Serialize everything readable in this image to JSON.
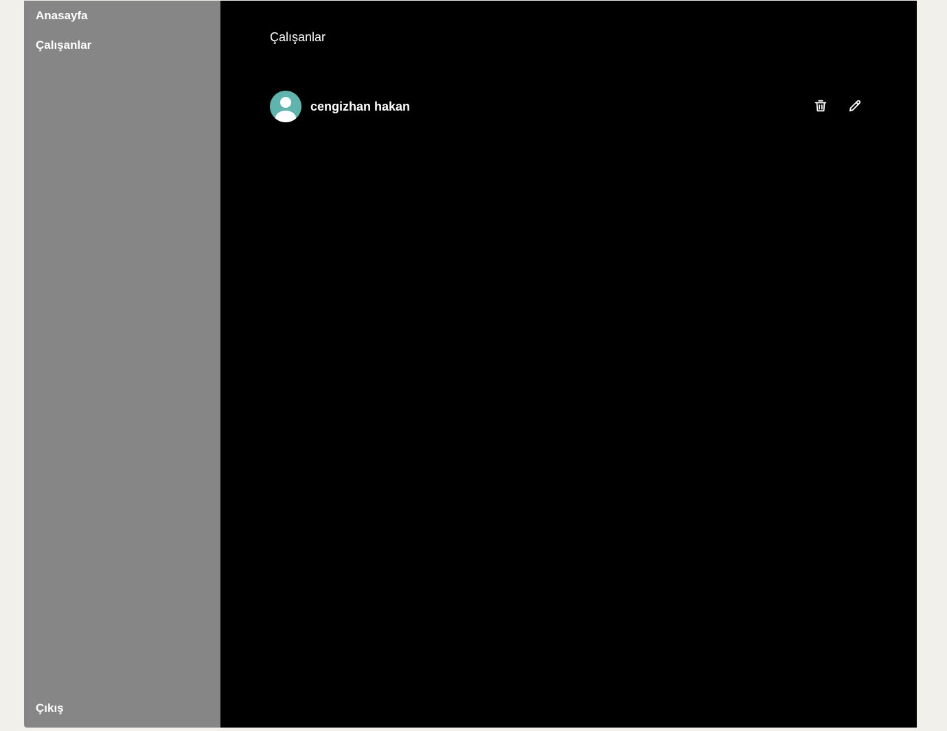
{
  "sidebar": {
    "items": [
      {
        "label": "Anasayfa"
      },
      {
        "label": "Çalışanlar"
      }
    ],
    "logout_label": "Çıkış"
  },
  "main": {
    "title": "Çalışanlar",
    "employees": [
      {
        "name": "cengizhan hakan",
        "avatar_icon": "user-avatar-icon",
        "actions": [
          {
            "icon": "trash-icon"
          },
          {
            "icon": "pencil-icon"
          }
        ]
      }
    ]
  },
  "colors": {
    "background": "#f2f0ea",
    "sidebar": "#868686",
    "main": "#000000",
    "avatar": "#5fb5ad",
    "text": "#ffffff"
  }
}
